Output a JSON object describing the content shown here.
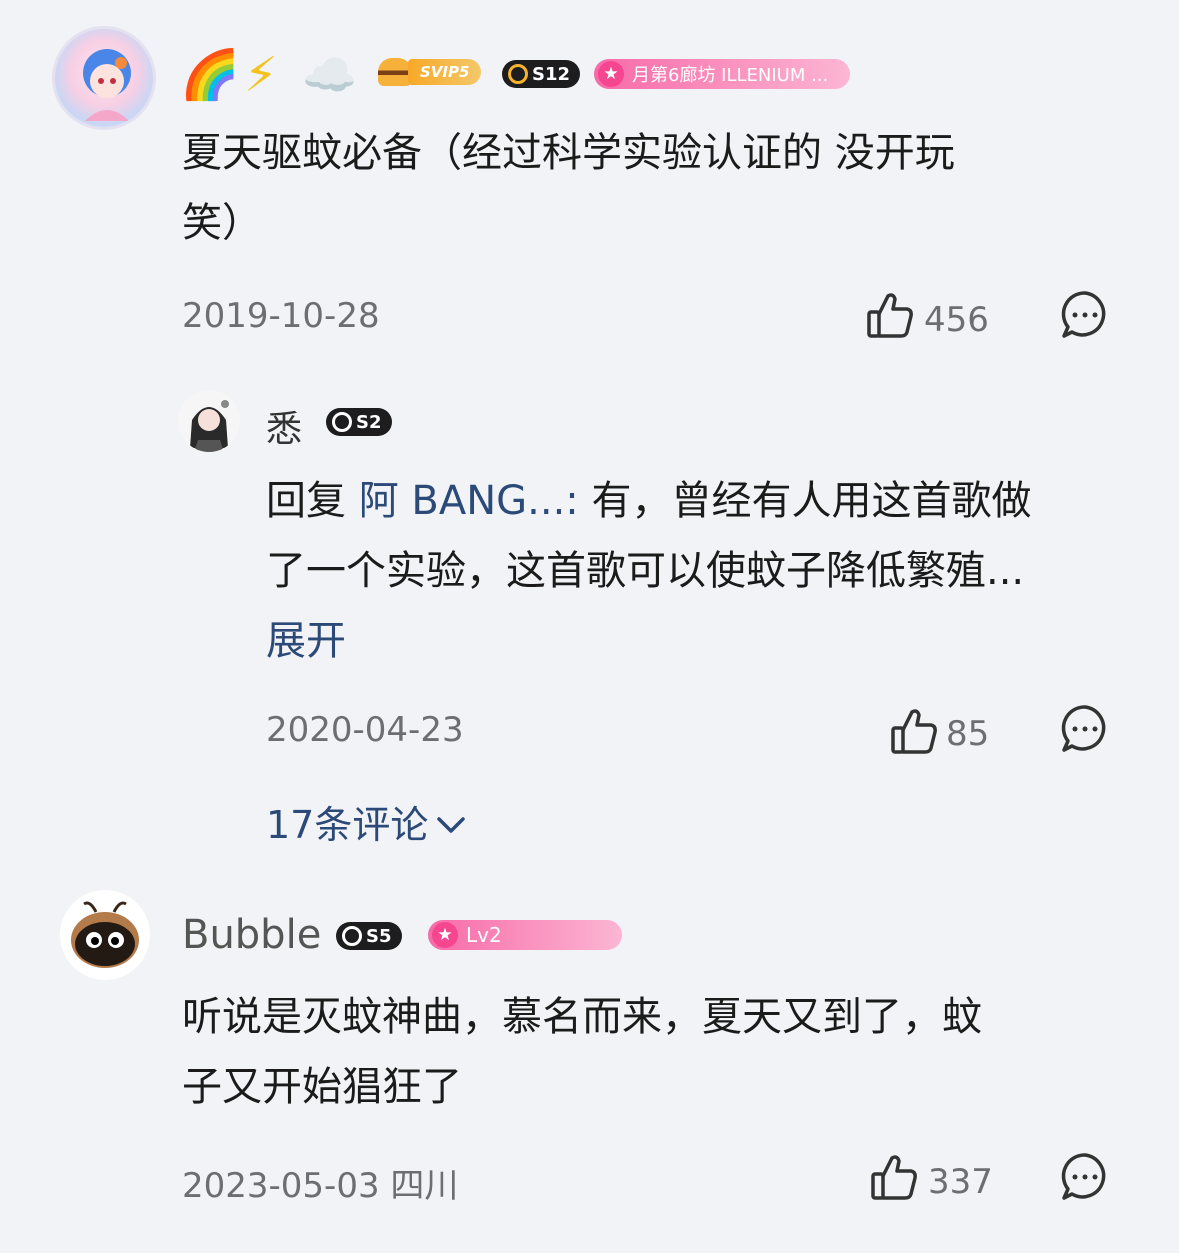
{
  "comments": [
    {
      "badges": {
        "vip": "SVIP5",
        "season": "S12",
        "medal_text": "月第6廊坊 ILLENIUM ..."
      },
      "emoji": [
        "🌈",
        "⚡",
        "☁️"
      ],
      "text_line1": "夏天驱蚊必备（经过科学实验认证的  没开玩",
      "text_line2": "笑）",
      "date": "2019-10-28",
      "likes": "456",
      "reply": {
        "username": "悉",
        "season": "S2",
        "prefix": "回复",
        "mention": "阿 BANG...:",
        "line1": "有，曾经有人用这首歌做",
        "line2": "了一个实验，这首歌可以使蚊子降低繁殖...",
        "expand": "展开",
        "date": "2020-04-23",
        "likes": "85"
      },
      "more_replies": "17条评论"
    },
    {
      "username": "Bubble",
      "badges": {
        "season": "S5",
        "level": "Lv2"
      },
      "text_line1": "听说是灭蚊神曲，慕名而来，夏天又到了，蚊",
      "text_line2": "子又开始猖狂了",
      "date": "2023-05-03 四川",
      "likes": "337"
    }
  ],
  "colors": {
    "background": "#f2f3f7",
    "link": "#2c4a78",
    "secondary": "#6e6e72",
    "pink": "#f5468f"
  },
  "icons": [
    "thumb-up-icon",
    "comment-bubble-icon",
    "chevron-down-icon",
    "star-icon"
  ]
}
